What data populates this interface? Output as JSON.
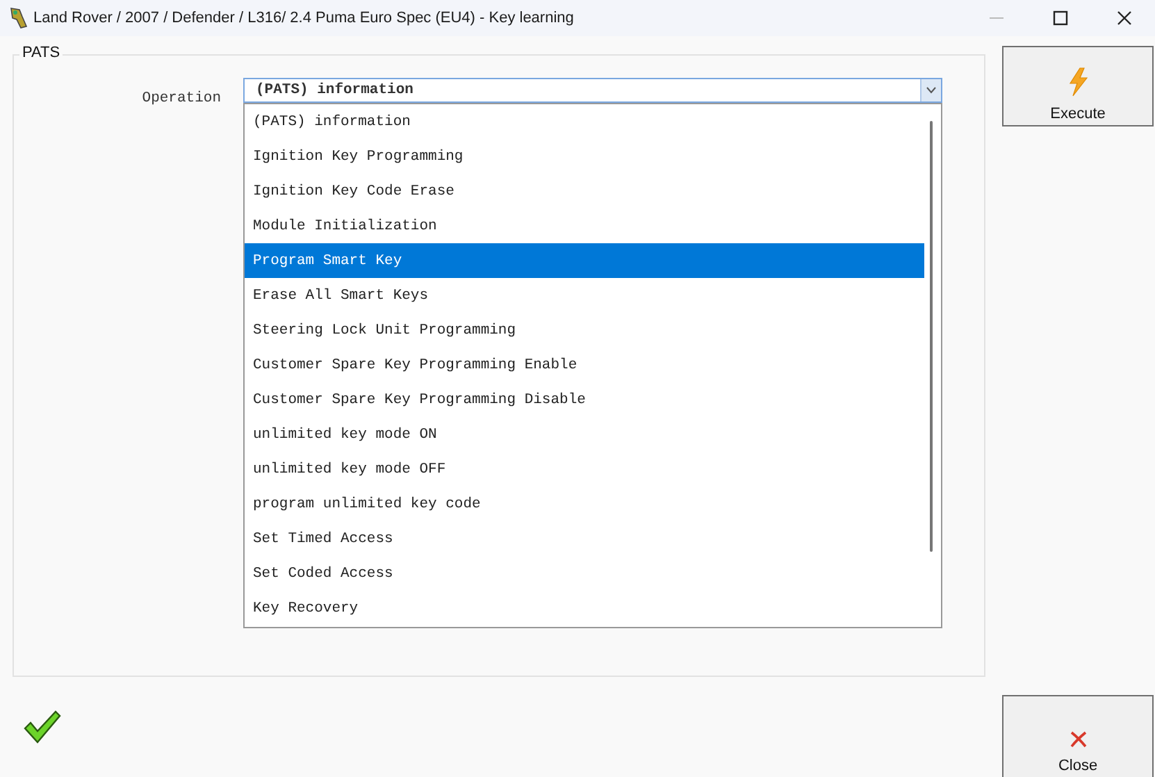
{
  "window": {
    "title": "Land Rover / 2007 / Defender / L316/ 2.4 Puma Euro Spec (EU4) - Key learning"
  },
  "group": {
    "title": "PATS"
  },
  "operation": {
    "label": "Operation",
    "value": "(PATS) information",
    "expanded": true,
    "options": [
      {
        "label": "(PATS) information",
        "highlighted": false
      },
      {
        "label": "Ignition Key Programming",
        "highlighted": false
      },
      {
        "label": "Ignition Key Code Erase",
        "highlighted": false
      },
      {
        "label": "Module Initialization",
        "highlighted": false
      },
      {
        "label": "Program Smart Key",
        "highlighted": true
      },
      {
        "label": "Erase All Smart Keys",
        "highlighted": false
      },
      {
        "label": "Steering Lock Unit Programming",
        "highlighted": false
      },
      {
        "label": "Customer Spare Key Programming Enable",
        "highlighted": false
      },
      {
        "label": "Customer Spare Key Programming Disable",
        "highlighted": false
      },
      {
        "label": "unlimited key mode ON",
        "highlighted": false
      },
      {
        "label": "unlimited key mode OFF",
        "highlighted": false
      },
      {
        "label": "program unlimited key code",
        "highlighted": false
      },
      {
        "label": "Set Timed Access",
        "highlighted": false
      },
      {
        "label": "Set Coded Access",
        "highlighted": false
      },
      {
        "label": "Key Recovery",
        "highlighted": false
      }
    ]
  },
  "buttons": [
    {
      "kind": "execute",
      "label": "Execute"
    },
    {
      "kind": "close",
      "label": "Close"
    }
  ]
}
